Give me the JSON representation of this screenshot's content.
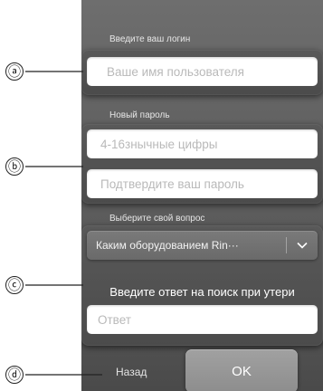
{
  "login_section": {
    "label": "Введите ваш логин",
    "username_placeholder": "Ваше имя пользователя"
  },
  "password_section": {
    "label": "Новый пароль",
    "password_placeholder": "4-16знычные цифры",
    "confirm_placeholder": "Подтвердите ваш пароль"
  },
  "question_section": {
    "label": "Выберите свой вопрос",
    "selected_question": "Каким оборудованием Rin···",
    "answer_prompt": "Введите ответ на поиск при утери",
    "answer_placeholder": "Ответ"
  },
  "footer": {
    "back_label": "Назад",
    "ok_label": "OK"
  },
  "callouts": {
    "a": "ⓐ",
    "b": "ⓑ",
    "c": "ⓒ",
    "d": "ⓓ"
  }
}
